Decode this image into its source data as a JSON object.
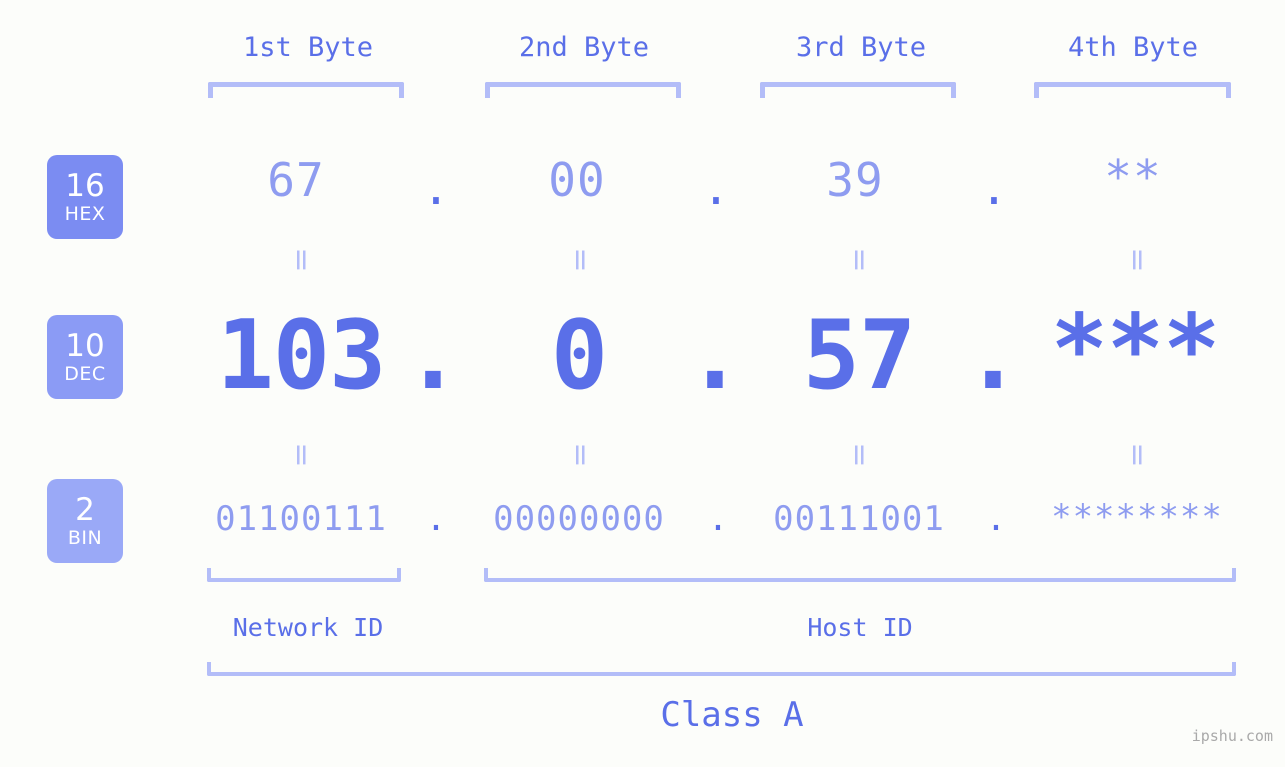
{
  "meta": {
    "background_color": "#fcfdfa",
    "accent_color": "#5a6fe8",
    "accent_light_color": "#8e9cf0",
    "bracket_color": "#b3bdf8",
    "badge_hex_color": "#7b8cf2",
    "badge_dec_color": "#8b9bf5",
    "badge_bin_color": "#9aa9f7",
    "watermark_color": "#a9a9a9"
  },
  "header": {
    "byte_labels": [
      {
        "text": "1st Byte"
      },
      {
        "text": "2nd Byte"
      },
      {
        "text": "3rd Byte"
      },
      {
        "text": "4th Byte"
      }
    ]
  },
  "badges": [
    {
      "num": "16",
      "abbr": "HEX"
    },
    {
      "num": "10",
      "abbr": "DEC"
    },
    {
      "num": "2",
      "abbr": "BIN"
    }
  ],
  "rows": {
    "hex": {
      "values": [
        "67",
        "00",
        "39",
        "**"
      ],
      "separator": "."
    },
    "dec": {
      "values": [
        "103",
        "0",
        "57",
        "***"
      ],
      "separator": "."
    },
    "bin": {
      "values": [
        "01100111",
        "00000000",
        "00111001",
        "********"
      ],
      "separator": "."
    }
  },
  "separators": {
    "equals": "="
  },
  "footer": {
    "network_id_label": "Network ID",
    "host_id_label": "Host ID",
    "class_label": "Class A"
  },
  "watermark": {
    "text": "ipshu.com"
  }
}
